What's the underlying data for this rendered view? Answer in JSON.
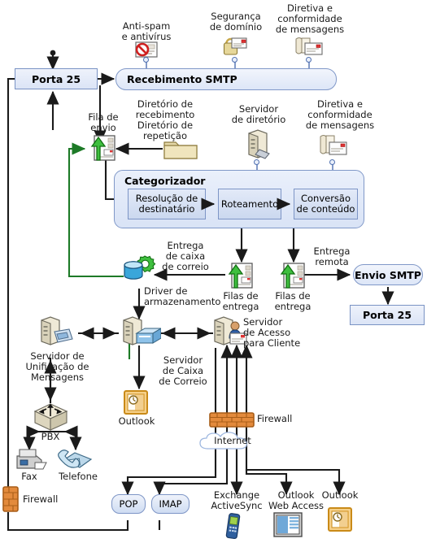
{
  "diagram": {
    "title": "Fluxo de mensagens do Exchange",
    "language": "pt-BR",
    "colors": {
      "box_fill": "#dbe4f6",
      "box_border": "#7a93c4",
      "flow_arrow": "#1a1a1a",
      "store_arrow": "#1d7a27",
      "firewall": "#e38a3c",
      "outlook": "#e6a33a"
    }
  },
  "nodes": {
    "porta25_top": "Porta 25",
    "recebimento_smtp": "Recebimento SMTP",
    "envio_smtp": "Envio SMTP",
    "porta25_bottom": "Porta 25",
    "categorizador": "Categorizador",
    "cat_resolucao": "Resolução de\ndestinatário",
    "cat_roteamento": "Roteamento",
    "cat_conversao": "Conversão\nde conteúdo",
    "pop": "POP",
    "imap": "IMAP"
  },
  "labels": {
    "antispam": "Anti-spam\ne antivírus",
    "seguranca_dominio": "Segurança\nde domínio",
    "diretiva_top": "Diretiva e\nconformidade\nde mensagens",
    "fila_envio": "Fila de\nenvio",
    "diretorio_recebimento": "Diretório de\nrecebimento\nDiretório de\nrepetição",
    "servidor_diretorio": "Servidor\nde diretório",
    "diretiva_mid": "Diretiva e\nconformidade\nde mensagens",
    "entrega_caixa": "Entrega\nde caixa\nde correio",
    "filas_entrega_1": "Filas de\nentrega",
    "filas_entrega_2": "Filas de\nentrega",
    "entrega_remota": "Entrega\nremota",
    "driver_armazenamento": "Driver de\narmazenamento",
    "servidor_unificacao": "Servidor de\nUnificação de\nMensagens",
    "servidor_caixa_correio": "Servidor\nde Caixa\nde Correio",
    "servidor_acesso_cliente": "Servidor\nde Acesso\npara Cliente",
    "outlook_internal": "Outlook",
    "firewall_internal": "Firewall",
    "internet": "Internet",
    "pbx": "PBX",
    "fax": "Fax",
    "telefone": "Telefone",
    "firewall_external": "Firewall",
    "exchange_activesync": "Exchange\nActiveSync",
    "outlook_web_access": "Outlook\nWeb Access",
    "outlook_external": "Outlook"
  },
  "icons": {
    "antispam": "blocked-message-icon",
    "seguranca_dominio": "lock-message-icon",
    "diretiva_top": "policy-scroll-message-icon",
    "fila_envio": "queue-message-icon",
    "diretorio_recebimento": "folder-icon",
    "servidor_diretorio": "directory-server-icon",
    "diretiva_mid": "policy-scroll-message-icon",
    "mailbox_store": "database-cylinder-icon",
    "filas_entrega_1": "queue-message-icon",
    "filas_entrega_2": "queue-message-icon",
    "servidor_unificacao": "um-server-icon",
    "servidor_caixa_correio": "mailbox-server-icon",
    "servidor_acesso_cliente": "client-access-server-icon",
    "outlook_internal": "outlook-icon",
    "firewall_internal": "firewall-brick-icon",
    "internet": "cloud-icon",
    "pbx": "pbx-icon",
    "fax": "fax-icon",
    "telefone": "telephone-icon",
    "firewall_external": "firewall-brick-icon",
    "exchange_activesync": "mobile-phone-icon",
    "outlook_web_access": "browser-window-icon",
    "outlook_external": "outlook-icon"
  }
}
